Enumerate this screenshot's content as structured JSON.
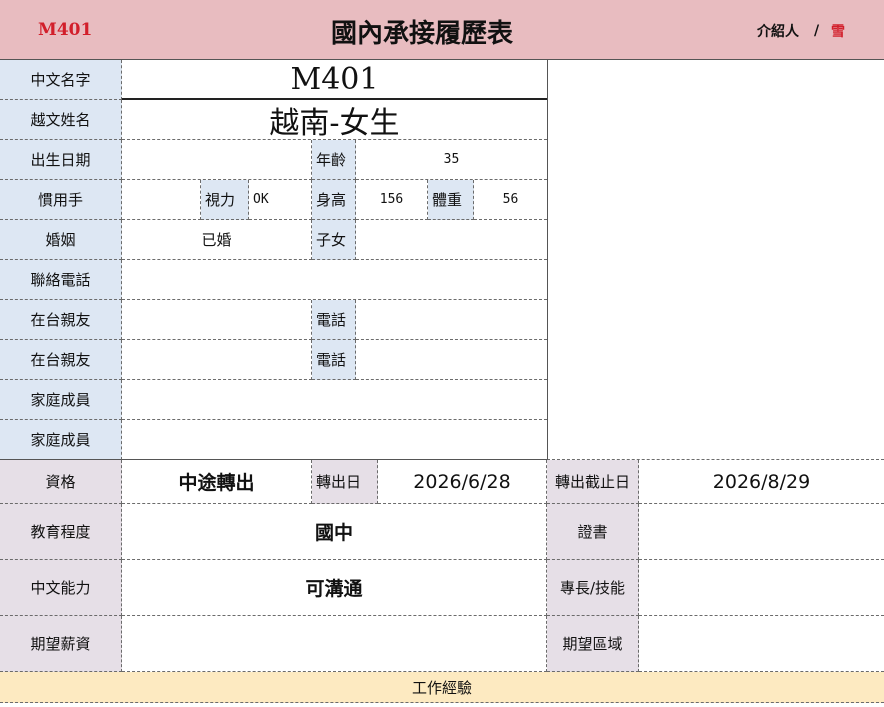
{
  "header": {
    "code": "M401",
    "title": "國內承接履歷表",
    "introducer_label": "介紹人",
    "slash": "/",
    "introducer_name": "雪"
  },
  "labels": {
    "chinese_name": "中文名字",
    "viet_name": "越文姓名",
    "birth": "出生日期",
    "age": "年齡",
    "hand": "慣用手",
    "vision": "視力",
    "height": "身高",
    "weight": "體重",
    "marriage": "婚姻",
    "children": "子女",
    "phone": "聯絡電話",
    "friend1": "在台親友",
    "friend1_phone": "電話",
    "friend2": "在台親友",
    "friend2_phone": "電話",
    "family1": "家庭成員",
    "family2": "家庭成員",
    "qualification": "資格",
    "transfer_date": "轉出日",
    "deadline": "轉出截止日",
    "education": "教育程度",
    "certificate": "證書",
    "chinese_ability": "中文能力",
    "skills": "專長/技能",
    "salary": "期望薪資",
    "area": "期望區域",
    "work_exp": "工作經驗"
  },
  "values": {
    "chinese_name": "M401",
    "viet_name": "越南-女生",
    "age": "35",
    "vision": "OK",
    "height": "156",
    "weight": "56",
    "marriage": "已婚",
    "qualification": "中途轉出",
    "transfer_date": "2026/6/28",
    "deadline": "2026/8/29",
    "education": "國中",
    "chinese_ability": "可溝通"
  },
  "colors": {
    "header_bg": "#e8bcc0",
    "label_blue": "#dde7f3",
    "label_mauve": "#e6dfe7",
    "footer_yellow": "#fdeac1",
    "code_red": "#d21f2b"
  }
}
